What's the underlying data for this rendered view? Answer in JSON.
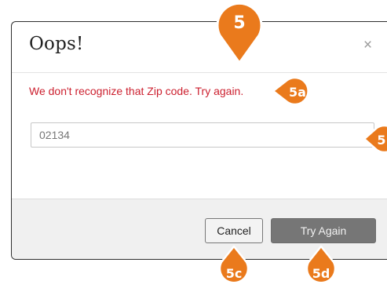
{
  "dialog": {
    "title": "Oops!",
    "close_glyph": "×",
    "error_message": "We don't recognize that Zip code. Try again.",
    "zip_value": "02134",
    "cancel_label": "Cancel",
    "try_again_label": "Try Again"
  },
  "callouts": {
    "main": "5",
    "error": "5a",
    "input": "5",
    "cancel": "5c",
    "try_again": "5d"
  },
  "colors": {
    "error": "#cc1f2e",
    "callout_fill": "#ea7a1c",
    "callout_border": "#ffffff",
    "primary_button": "#767676"
  }
}
